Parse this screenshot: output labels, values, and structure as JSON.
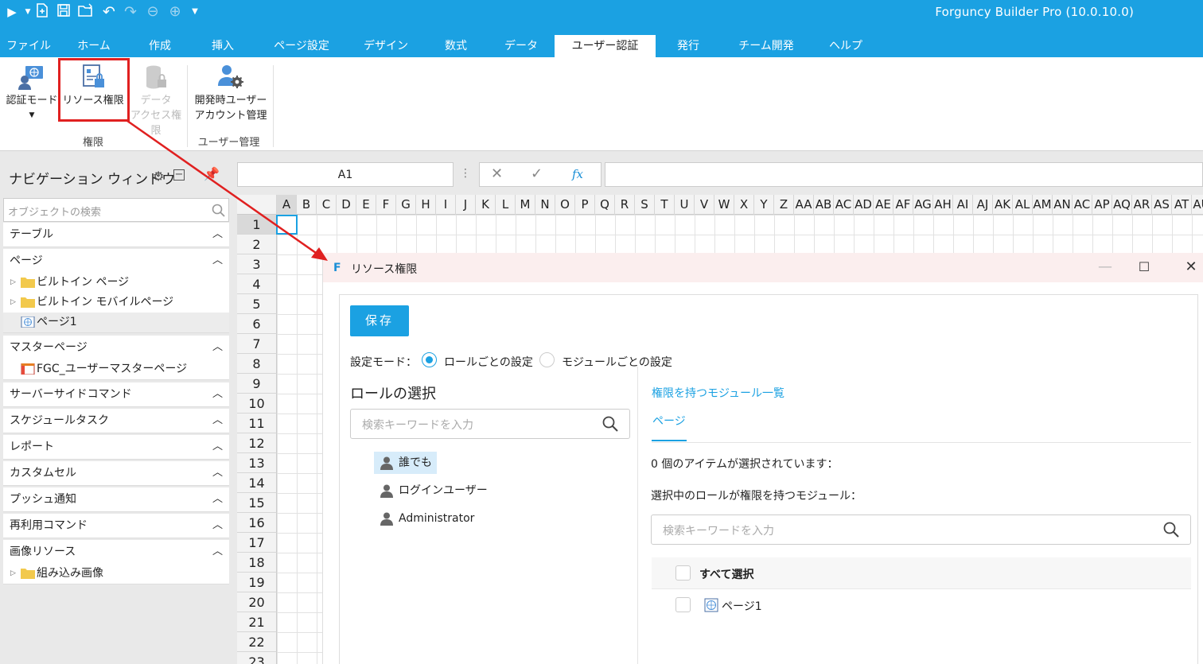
{
  "app": {
    "title": "Forguncy Builder Pro (10.0.10.0)"
  },
  "quick_access": [
    "run-icon",
    "dropdown-icon",
    "new-icon",
    "save-icon",
    "open-icon",
    "undo-icon",
    "redo-icon",
    "back-icon",
    "forward-icon",
    "customize-icon"
  ],
  "tabs": [
    "ファイル",
    "ホーム",
    "作成",
    "挿入",
    "ページ設定",
    "デザイン",
    "数式",
    "データ",
    "ユーザー認証",
    "発行",
    "チーム開発",
    "ヘルプ"
  ],
  "active_tab": "ユーザー認証",
  "ribbon": {
    "auth_mode_label": "認証モード",
    "resource_perm_label": "リソース権限",
    "data_access_line1": "データ",
    "data_access_line2": "アクセス権限",
    "dev_user_line1": "開発時ユーザー",
    "dev_user_line2": "アカウント管理",
    "group_perm": "権限",
    "group_user_mgmt": "ユーザー管理"
  },
  "nav": {
    "title": "ナビゲーション ウィンドウ",
    "search_placeholder": "オブジェクトの検索",
    "sections": {
      "table": "テーブル",
      "page": "ページ",
      "builtin_page": "ビルトイン ページ",
      "builtin_mobile": "ビルトイン モバイルページ",
      "page1": "ページ1",
      "master": "マスターページ",
      "master_item": "FGC_ユーザーマスターページ",
      "server_cmd": "サーバーサイドコマンド",
      "schedule": "スケジュールタスク",
      "report": "レポート",
      "custom_cell": "カスタムセル",
      "push": "プッシュ通知",
      "reuse_cmd": "再利用コマンド",
      "image": "画像リソース",
      "image_item": "組み込み画像"
    }
  },
  "formula": {
    "cell_ref": "A1",
    "fx": "fx",
    "value": ""
  },
  "grid": {
    "columns": [
      "A",
      "B",
      "C",
      "D",
      "E",
      "F",
      "G",
      "H",
      "I",
      "J",
      "K",
      "L",
      "M",
      "N",
      "O",
      "P",
      "Q",
      "R",
      "S",
      "T",
      "U",
      "V",
      "W",
      "X",
      "Y",
      "Z",
      "AA",
      "AB",
      "AC",
      "AD",
      "AE",
      "AF",
      "AG",
      "AH",
      "AI",
      "AJ",
      "AK",
      "AL",
      "AM",
      "AN",
      "AC",
      "AP",
      "AQ",
      "AR",
      "AS",
      "AT",
      "AU"
    ],
    "rows": [
      "1",
      "2",
      "3",
      "4",
      "5",
      "6",
      "7",
      "8",
      "9",
      "10",
      "11",
      "12",
      "13",
      "14",
      "15",
      "16",
      "17",
      "18",
      "19",
      "20",
      "21",
      "22",
      "23"
    ]
  },
  "dialog": {
    "title": "リソース権限",
    "save": "保存",
    "mode_label": "設定モード：",
    "mode_role": "ロールごとの設定",
    "mode_module": "モジュールごとの設定",
    "selected_mode": "ロールごとの設定",
    "role_title": "ロールの選択",
    "search_placeholder": "検索キーワードを入力",
    "roles": [
      "誰でも",
      "ログインユーザー",
      "Administrator"
    ],
    "selected_role": "誰でも",
    "module_link": "権限を持つモジュール一覧",
    "page_tab": "ページ",
    "selected_count_text": "0 個のアイテムが選択されています：",
    "role_modules_label": "選択中のロールが権限を持つモジュール：",
    "module_search_placeholder": "検索キーワードを入力",
    "select_all": "すべて選択",
    "module_items": [
      "ページ1"
    ]
  },
  "colors": {
    "accent": "#1ba1e2",
    "highlight": "#e02020"
  }
}
